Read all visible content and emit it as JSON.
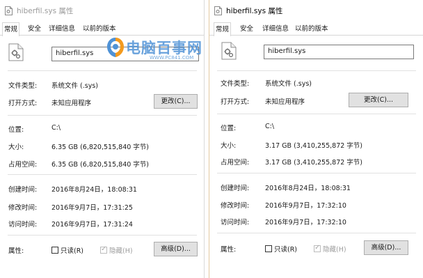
{
  "left": {
    "title": "hiberfil.sys 属性",
    "tabs": [
      "常规",
      "安全",
      "详细信息",
      "以前的版本"
    ],
    "filename": "hiberfil.sys",
    "type_label": "文件类型:",
    "type_value": "系统文件 (.sys)",
    "opens_label": "打开方式:",
    "opens_value": "未知应用程序",
    "change_button": "更改(C)...",
    "location_label": "位置:",
    "location_value": "C:\\",
    "size_label": "大小:",
    "size_value": "6.35 GB (6,820,515,840 字节)",
    "disk_label": "占用空间:",
    "disk_value": "6.35 GB (6,820,515,840 字节)",
    "created_label": "创建时间:",
    "created_value": "2016年8月24日，18:08:31",
    "modified_label": "修改时间:",
    "modified_value": "2016年9月7日，17:31:25",
    "accessed_label": "访问时间:",
    "accessed_value": "2016年9月7日，17:31:24",
    "attr_label": "属性:",
    "readonly": "只读(R)",
    "hidden": "隐藏(H)",
    "advanced_button": "高级(D)..."
  },
  "right": {
    "title": "hiberfil.sys 属性",
    "tabs": [
      "常规",
      "安全",
      "详细信息",
      "以前的版本"
    ],
    "filename": "hiberfil.sys",
    "type_label": "文件类型:",
    "type_value": "系统文件 (.sys)",
    "opens_label": "打开方式:",
    "opens_value": "未知应用程序",
    "change_button": "更改(C)...",
    "location_label": "位置:",
    "location_value": "C:\\",
    "size_label": "大小:",
    "size_value": "3.17 GB (3,410,255,872 字节)",
    "disk_label": "占用空间:",
    "disk_value": "3.17 GB (3,410,255,872 字节)",
    "created_label": "创建时间:",
    "created_value": "2016年8月24日，18:08:31",
    "modified_label": "修改时间:",
    "modified_value": "2016年9月7日，17:32:10",
    "accessed_label": "访问时间:",
    "accessed_value": "2016年9月7日，17:32:10",
    "attr_label": "属性:",
    "readonly": "只读(R)",
    "hidden": "隐藏(H)",
    "advanced_button": "高级(D)..."
  },
  "watermark": {
    "text": "电脑百事网",
    "url": "WWW.PC841.COM"
  },
  "colors": {
    "watermark_blue": "#4f92d6",
    "watermark_orange": "#f39a1e",
    "window_border_right": "#e3c9a0"
  }
}
